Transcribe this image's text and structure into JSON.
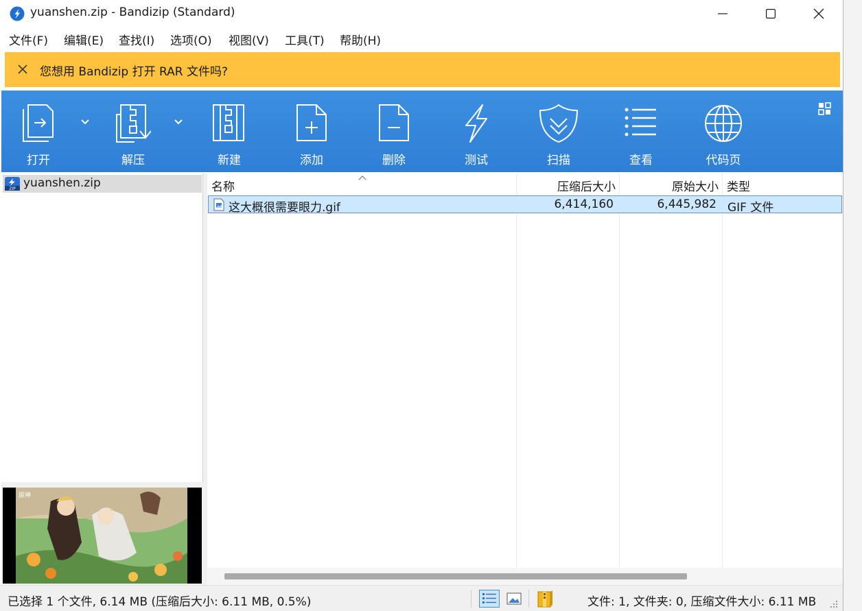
{
  "window": {
    "title": "yuanshen.zip - Bandizip (Standard)",
    "controls": {
      "minimize": "minimize-icon",
      "maximize": "maximize-icon",
      "close": "close-icon"
    }
  },
  "menu": [
    "文件(F)",
    "编辑(E)",
    "查找(I)",
    "选项(O)",
    "视图(V)",
    "工具(T)",
    "帮助(H)"
  ],
  "notice": {
    "text": "您想用 Bandizip 打开 RAR 文件吗?",
    "bg": "#fec23e"
  },
  "toolbar": {
    "accent": "#3388dd",
    "buttons": [
      {
        "label": "打开",
        "icon": "open-icon"
      },
      {
        "label": "解压",
        "icon": "extract-icon"
      },
      {
        "label": "新建",
        "icon": "new-archive-icon"
      },
      {
        "label": "添加",
        "icon": "add-file-icon"
      },
      {
        "label": "删除",
        "icon": "delete-file-icon"
      },
      {
        "label": "测试",
        "icon": "test-icon"
      },
      {
        "label": "扫描",
        "icon": "scan-shield-icon"
      },
      {
        "label": "查看",
        "icon": "view-list-icon"
      },
      {
        "label": "代码页",
        "icon": "globe-icon"
      }
    ]
  },
  "tree": {
    "items": [
      {
        "label": "yuanshen.zip",
        "icon": "zip-icon"
      }
    ]
  },
  "list": {
    "columns": [
      "名称",
      "压缩后大小",
      "原始大小",
      "类型"
    ],
    "rows": [
      {
        "name": "这大概很需要眼力.gif",
        "compressed": "6,414,160",
        "original": "6,445,982",
        "type": "GIF 文件"
      }
    ]
  },
  "status": {
    "left": "已选择 1 个文件, 6.14 MB (压缩后大小: 6.11 MB, 0.5%)",
    "right": "文件: 1, 文件夹: 0, 压缩文件大小: 6.11 MB"
  }
}
